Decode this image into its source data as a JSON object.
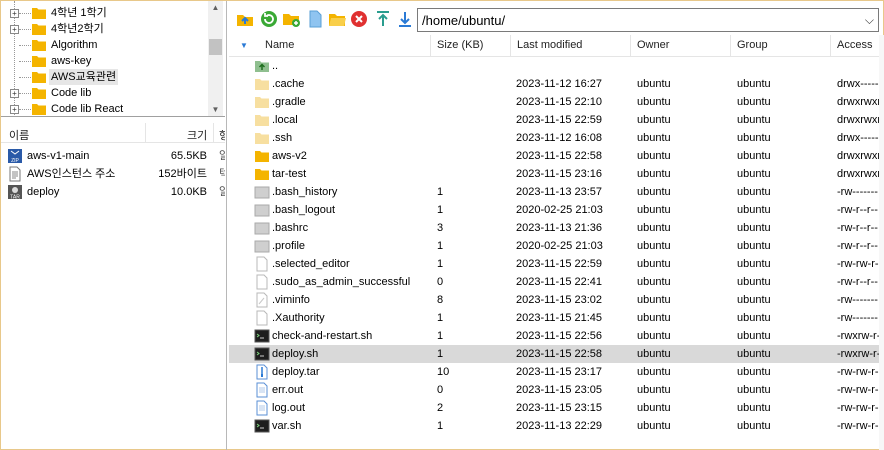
{
  "tree": {
    "items": [
      {
        "label": "4학년 1학기",
        "expander": "+"
      },
      {
        "label": "4학년2학기",
        "expander": "+"
      },
      {
        "label": "Algorithm",
        "expander": ""
      },
      {
        "label": "aws-key",
        "expander": ""
      },
      {
        "label": "AWS교육관련",
        "expander": "",
        "selected": true
      },
      {
        "label": "Code lib",
        "expander": "+"
      },
      {
        "label": "Code lib React",
        "expander": "+"
      }
    ]
  },
  "local": {
    "headers": {
      "name": "이름",
      "size": "크기",
      "cut": "형"
    },
    "files": [
      {
        "name": "aws-v1-main",
        "size": "65.5KB",
        "icon": "zip-icon",
        "cut": "알"
      },
      {
        "name": "AWS인스턴스 주소",
        "size": "152바이트",
        "icon": "text-file-icon",
        "cut": "텍"
      },
      {
        "name": "deploy",
        "size": "10.0KB",
        "icon": "tar-icon",
        "cut": "알"
      }
    ]
  },
  "toolbar": {
    "buttons": [
      "parent-folder",
      "refresh",
      "new-folder",
      "new-file",
      "open-folder",
      "delete",
      "upload",
      "download"
    ]
  },
  "path": {
    "value": "/home/ubuntu/"
  },
  "remote": {
    "headers": {
      "name": "Name",
      "size": "Size (KB)",
      "modified": "Last modified",
      "owner": "Owner",
      "group": "Group",
      "access": "Access"
    },
    "files": [
      {
        "name": "..",
        "size": "",
        "modified": "",
        "owner": "",
        "group": "",
        "access": "",
        "type": "up"
      },
      {
        "name": ".cache",
        "size": "",
        "modified": "2023-11-12 16:27",
        "owner": "ubuntu",
        "group": "ubuntu",
        "access": "drwx------",
        "type": "folder-hidden"
      },
      {
        "name": ".gradle",
        "size": "",
        "modified": "2023-11-15 22:10",
        "owner": "ubuntu",
        "group": "ubuntu",
        "access": "drwxrwxr-x",
        "type": "folder-hidden"
      },
      {
        "name": ".local",
        "size": "",
        "modified": "2023-11-15 22:59",
        "owner": "ubuntu",
        "group": "ubuntu",
        "access": "drwxrwxr-x",
        "type": "folder-hidden"
      },
      {
        "name": ".ssh",
        "size": "",
        "modified": "2023-11-12 16:08",
        "owner": "ubuntu",
        "group": "ubuntu",
        "access": "drwx------",
        "type": "folder-hidden"
      },
      {
        "name": "aws-v2",
        "size": "",
        "modified": "2023-11-15 22:58",
        "owner": "ubuntu",
        "group": "ubuntu",
        "access": "drwxrwxr-x",
        "type": "folder"
      },
      {
        "name": "tar-test",
        "size": "",
        "modified": "2023-11-15 23:16",
        "owner": "ubuntu",
        "group": "ubuntu",
        "access": "drwxrwxr-x",
        "type": "folder"
      },
      {
        "name": ".bash_history",
        "size": "1",
        "modified": "2023-11-13 23:57",
        "owner": "ubuntu",
        "group": "ubuntu",
        "access": "-rw-------",
        "type": "hidden-file"
      },
      {
        "name": ".bash_logout",
        "size": "1",
        "modified": "2020-02-25 21:03",
        "owner": "ubuntu",
        "group": "ubuntu",
        "access": "-rw-r--r--",
        "type": "hidden-file"
      },
      {
        "name": ".bashrc",
        "size": "3",
        "modified": "2023-11-13 21:36",
        "owner": "ubuntu",
        "group": "ubuntu",
        "access": "-rw-r--r--",
        "type": "hidden-file"
      },
      {
        "name": ".profile",
        "size": "1",
        "modified": "2020-02-25 21:03",
        "owner": "ubuntu",
        "group": "ubuntu",
        "access": "-rw-r--r--",
        "type": "hidden-file"
      },
      {
        "name": ".selected_editor",
        "size": "1",
        "modified": "2023-11-15 22:59",
        "owner": "ubuntu",
        "group": "ubuntu",
        "access": "-rw-rw-r--",
        "type": "file"
      },
      {
        "name": ".sudo_as_admin_successful",
        "size": "0",
        "modified": "2023-11-15 22:41",
        "owner": "ubuntu",
        "group": "ubuntu",
        "access": "-rw-r--r--",
        "type": "file"
      },
      {
        "name": ".viminfo",
        "size": "8",
        "modified": "2023-11-15 23:02",
        "owner": "ubuntu",
        "group": "ubuntu",
        "access": "-rw-------",
        "type": "vim-file"
      },
      {
        "name": ".Xauthority",
        "size": "1",
        "modified": "2023-11-15 21:45",
        "owner": "ubuntu",
        "group": "ubuntu",
        "access": "-rw-------",
        "type": "file"
      },
      {
        "name": "check-and-restart.sh",
        "size": "1",
        "modified": "2023-11-15 22:56",
        "owner": "ubuntu",
        "group": "ubuntu",
        "access": "-rwxrw-r--",
        "type": "script"
      },
      {
        "name": "deploy.sh",
        "size": "1",
        "modified": "2023-11-15 22:58",
        "owner": "ubuntu",
        "group": "ubuntu",
        "access": "-rwxrw-r--",
        "type": "script",
        "selected": true
      },
      {
        "name": "deploy.tar",
        "size": "10",
        "modified": "2023-11-15 23:17",
        "owner": "ubuntu",
        "group": "ubuntu",
        "access": "-rw-rw-r--",
        "type": "tar"
      },
      {
        "name": "err.out",
        "size": "0",
        "modified": "2023-11-15 23:05",
        "owner": "ubuntu",
        "group": "ubuntu",
        "access": "-rw-rw-r--",
        "type": "text"
      },
      {
        "name": "log.out",
        "size": "2",
        "modified": "2023-11-15 23:15",
        "owner": "ubuntu",
        "group": "ubuntu",
        "access": "-rw-rw-r--",
        "type": "text"
      },
      {
        "name": "var.sh",
        "size": "1",
        "modified": "2023-11-13 22:29",
        "owner": "ubuntu",
        "group": "ubuntu",
        "access": "-rw-rw-r--",
        "type": "script"
      }
    ]
  },
  "colors": {
    "folder": "#f4b400",
    "folder_hidden": "#f7dfa0",
    "accent": "#2a7ad5",
    "selection": "#d9d9d9"
  }
}
